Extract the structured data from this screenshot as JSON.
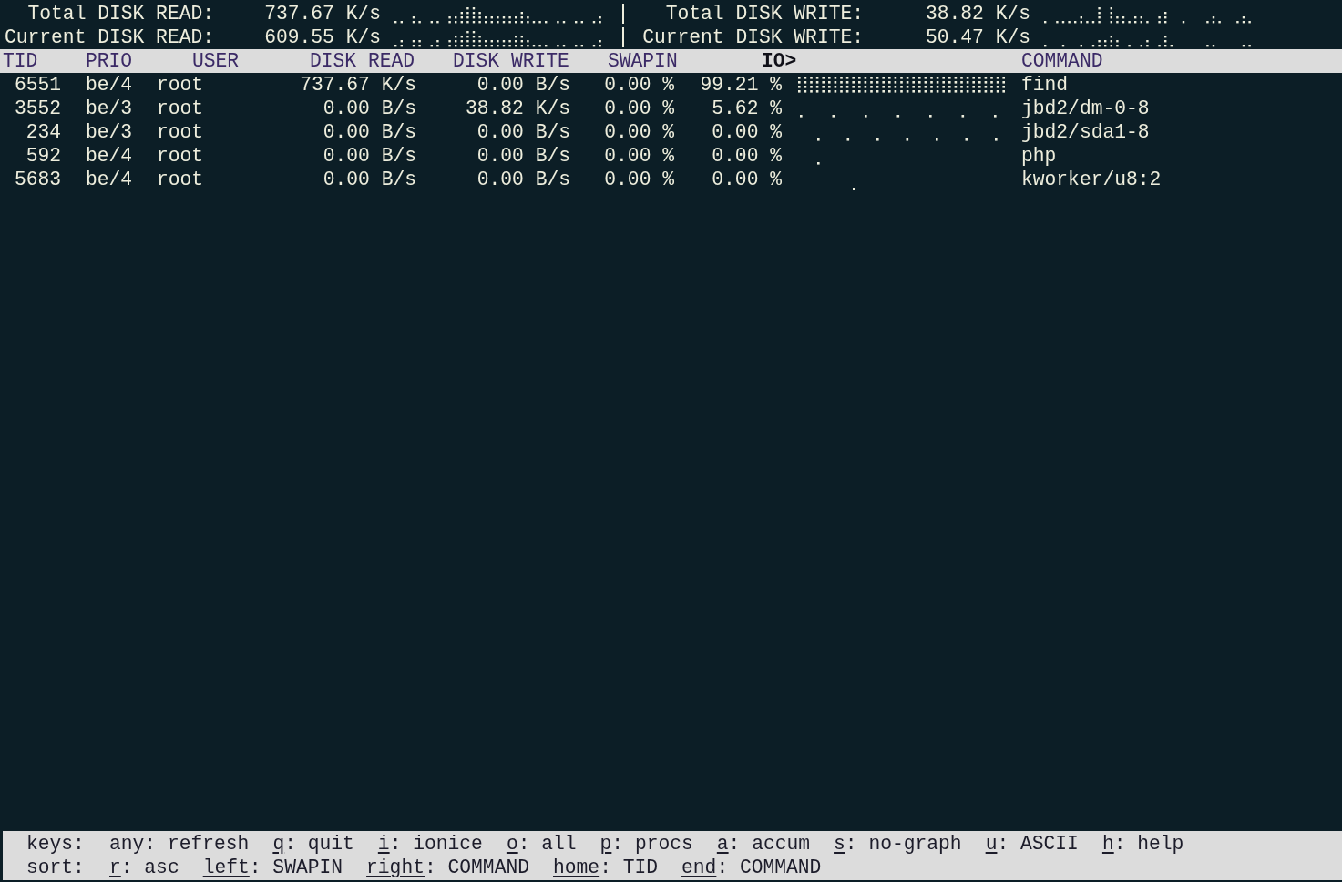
{
  "summary": [
    {
      "read_label": "Total DISK READ:",
      "read_value": "737.67 K/s",
      "write_label": "Total DISK WRITE:",
      "write_value": "38.82 K/s"
    },
    {
      "read_label": "Current DISK READ:",
      "read_value": "609.55 K/s",
      "write_label": "Current DISK WRITE:",
      "write_value": "50.47 K/s"
    }
  ],
  "columns": [
    {
      "label": "TID",
      "sorted": false
    },
    {
      "label": "PRIO",
      "sorted": false
    },
    {
      "label": "USER",
      "sorted": false
    },
    {
      "label": "DISK READ",
      "sorted": false
    },
    {
      "label": "DISK WRITE",
      "sorted": false
    },
    {
      "label": "SWAPIN",
      "sorted": false
    },
    {
      "label": "IO>",
      "sorted": true
    },
    {
      "label": "COMMAND",
      "sorted": false
    }
  ],
  "rows": [
    {
      "tid": "6551",
      "prio": "be/4",
      "user": "root",
      "disk_read": "737.67 K/s",
      "disk_write": "0.00 B/s",
      "swapin": "0.00 %",
      "io": "99.21 %",
      "command": "find"
    },
    {
      "tid": "3552",
      "prio": "be/3",
      "user": "root",
      "disk_read": "0.00 B/s",
      "disk_write": "38.82 K/s",
      "swapin": "0.00 %",
      "io": "5.62 %",
      "command": "jbd2/dm-0-8"
    },
    {
      "tid": "234",
      "prio": "be/3",
      "user": "root",
      "disk_read": "0.00 B/s",
      "disk_write": "0.00 B/s",
      "swapin": "0.00 %",
      "io": "0.00 %",
      "command": "jbd2/sda1-8"
    },
    {
      "tid": "592",
      "prio": "be/4",
      "user": "root",
      "disk_read": "0.00 B/s",
      "disk_write": "0.00 B/s",
      "swapin": "0.00 %",
      "io": "0.00 %",
      "command": "php"
    },
    {
      "tid": "5683",
      "prio": "be/4",
      "user": "root",
      "disk_read": "0.00 B/s",
      "disk_write": "0.00 B/s",
      "swapin": "0.00 %",
      "io": "0.00 %",
      "command": "kworker/u8:2"
    }
  ],
  "key_lines": [
    {
      "label": "keys:",
      "items": [
        {
          "key": "any",
          "action": ": refresh",
          "underlined": false
        },
        {
          "key": "q",
          "action": ": quit",
          "underlined": true
        },
        {
          "key": "i",
          "action": ": ionice",
          "underlined": true
        },
        {
          "key": "o",
          "action": ": all",
          "underlined": true
        },
        {
          "key": "p",
          "action": ": procs",
          "underlined": true
        },
        {
          "key": "a",
          "action": ": accum",
          "underlined": true
        },
        {
          "key": "s",
          "action": ": no-graph",
          "underlined": true
        },
        {
          "key": "u",
          "action": ": ASCII",
          "underlined": true
        },
        {
          "key": "h",
          "action": ": help",
          "underlined": true
        }
      ]
    },
    {
      "label": "sort:",
      "items": [
        {
          "key": "r",
          "action": ": asc",
          "underlined": true
        },
        {
          "key": "left",
          "action": ": SWAPIN",
          "underlined": true
        },
        {
          "key": "right",
          "action": ": COMMAND",
          "underlined": true
        },
        {
          "key": "home",
          "action": ": TID",
          "underlined": true
        },
        {
          "key": "end",
          "action": ": COMMAND",
          "underlined": true
        }
      ]
    }
  ]
}
